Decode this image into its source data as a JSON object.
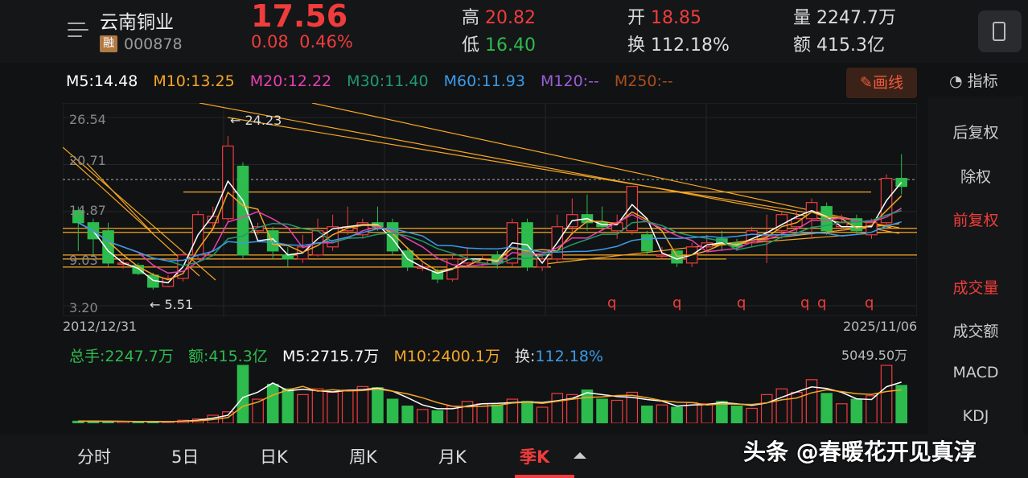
{
  "header": {
    "name": "云南铜业",
    "rong": "融",
    "code": "000878",
    "price": "17.56",
    "change": "0.08",
    "change_pct": "0.46%",
    "high_label": "高",
    "high": "20.82",
    "low_label": "低",
    "low": "16.40",
    "open_label": "开",
    "open": "18.85",
    "turnover_label": "换",
    "turnover": "112.18%",
    "volume_label": "量",
    "volume": "2247.7万",
    "amount_label": "额",
    "amount": "415.3亿"
  },
  "ma": {
    "m5": "M5:14.48",
    "m10": "M10:13.25",
    "m20": "M20:12.22",
    "m30": "M30:11.40",
    "m60": "M60:11.93",
    "m120": "M120:--",
    "m250": "M250:--"
  },
  "draw_button": "画线",
  "indicator_label": "指标",
  "chart": {
    "y_labels": [
      "26.54",
      "20.71",
      "14.87",
      "9.03",
      "3.20"
    ],
    "annot_high": "24.23",
    "annot_low": "5.51",
    "date_start": "2012/12/31",
    "date_end": "2025/11/06",
    "q_markers": [
      "q",
      "q",
      "q",
      "q",
      "q",
      "q"
    ]
  },
  "volume": {
    "total": "总手:2247.7万",
    "amount": "额:415.3亿",
    "m5": "M5:2715.7万",
    "m10": "M10:2400.1万",
    "turnover_label": "换:",
    "turnover": "112.18%",
    "max": "5049.50万"
  },
  "right_panel": {
    "items": [
      "后复权",
      "除权",
      "前复权",
      "成交量",
      "成交额",
      "MACD",
      "KDJ"
    ]
  },
  "tabs": [
    "分时",
    "5日",
    "日K",
    "周K",
    "月K",
    "季K"
  ],
  "watermark": "头条 @春暖花开见真淳",
  "colors": {
    "up": "#f03c3c",
    "down": "#2dbb4d",
    "accent": "#f05a3c"
  },
  "chart_data": {
    "type": "candlestick",
    "ylim": [
      3.2,
      26.54
    ],
    "candles": [
      {
        "o": 15.0,
        "c": 13.5,
        "h": 15.5,
        "l": 10.0
      },
      {
        "o": 13.5,
        "c": 11.5,
        "h": 14.0,
        "l": 9.5
      },
      {
        "o": 12.5,
        "c": 8.5,
        "h": 13.5,
        "l": 8.0
      },
      {
        "o": 8.5,
        "c": 8.5,
        "h": 9.0,
        "l": 7.8
      },
      {
        "o": 8.2,
        "c": 7.2,
        "h": 8.5,
        "l": 7.0
      },
      {
        "o": 7.0,
        "c": 5.5,
        "h": 7.3,
        "l": 5.2
      },
      {
        "o": 5.6,
        "c": 6.6,
        "h": 7.0,
        "l": 5.5
      },
      {
        "o": 6.6,
        "c": 9.5,
        "h": 10.0,
        "l": 6.2
      },
      {
        "o": 9.5,
        "c": 14.5,
        "h": 15.0,
        "l": 9.0
      },
      {
        "o": 13.5,
        "c": 14.3,
        "h": 15.5,
        "l": 12.5
      },
      {
        "o": 14.0,
        "c": 23.0,
        "h": 24.23,
        "l": 13.5
      },
      {
        "o": 20.5,
        "c": 9.5,
        "h": 21.0,
        "l": 9.0
      },
      {
        "o": 12.5,
        "c": 13.0,
        "h": 13.5,
        "l": 12.0
      },
      {
        "o": 12.5,
        "c": 10.0,
        "h": 13.0,
        "l": 9.0
      },
      {
        "o": 9.5,
        "c": 9.0,
        "h": 10.5,
        "l": 8.0
      },
      {
        "o": 9.0,
        "c": 10.5,
        "h": 12.0,
        "l": 8.5
      },
      {
        "o": 9.5,
        "c": 12.5,
        "h": 14.0,
        "l": 9.3
      },
      {
        "o": 10.5,
        "c": 13.0,
        "h": 14.5,
        "l": 10.0
      },
      {
        "o": 12.5,
        "c": 13.0,
        "h": 15.5,
        "l": 12.0
      },
      {
        "o": 12.0,
        "c": 13.5,
        "h": 14.0,
        "l": 11.5
      },
      {
        "o": 13.5,
        "c": 13.0,
        "h": 15.5,
        "l": 12.5
      },
      {
        "o": 13.5,
        "c": 10.0,
        "h": 14.0,
        "l": 9.5
      },
      {
        "o": 10.0,
        "c": 8.0,
        "h": 10.5,
        "l": 7.5
      },
      {
        "o": 8.0,
        "c": 8.0,
        "h": 8.5,
        "l": 7.5
      },
      {
        "o": 7.5,
        "c": 6.5,
        "h": 7.8,
        "l": 6.0
      },
      {
        "o": 6.5,
        "c": 9.0,
        "h": 9.5,
        "l": 6.2
      },
      {
        "o": 8.5,
        "c": 9.0,
        "h": 10.5,
        "l": 8.0
      },
      {
        "o": 8.5,
        "c": 9.0,
        "h": 9.5,
        "l": 8.0
      },
      {
        "o": 9.5,
        "c": 8.5,
        "h": 10.0,
        "l": 7.8
      },
      {
        "o": 8.5,
        "c": 13.5,
        "h": 14.0,
        "l": 8.0
      },
      {
        "o": 13.5,
        "c": 8.0,
        "h": 14.0,
        "l": 7.5
      },
      {
        "o": 8.0,
        "c": 9.0,
        "h": 9.5,
        "l": 7.5
      },
      {
        "o": 9.0,
        "c": 13.0,
        "h": 14.5,
        "l": 8.5
      },
      {
        "o": 13.0,
        "c": 14.5,
        "h": 16.5,
        "l": 12.0
      },
      {
        "o": 14.5,
        "c": 13.5,
        "h": 17.0,
        "l": 12.5
      },
      {
        "o": 13.5,
        "c": 13.0,
        "h": 15.5,
        "l": 12.5
      },
      {
        "o": 12.5,
        "c": 13.5,
        "h": 14.5,
        "l": 11.5
      },
      {
        "o": 12.5,
        "c": 18.0,
        "h": 18.0,
        "l": 12.0
      },
      {
        "o": 12.0,
        "c": 10.0,
        "h": 12.5,
        "l": 9.5
      },
      {
        "o": 9.5,
        "c": 9.5,
        "h": 10.5,
        "l": 9.0
      },
      {
        "o": 10.0,
        "c": 8.5,
        "h": 10.0,
        "l": 8.0
      },
      {
        "o": 8.5,
        "c": 10.5,
        "h": 11.0,
        "l": 8.0
      },
      {
        "o": 10.5,
        "c": 11.0,
        "h": 12.0,
        "l": 10.0
      },
      {
        "o": 11.5,
        "c": 11.0,
        "h": 12.5,
        "l": 10.0
      },
      {
        "o": 11.0,
        "c": 10.5,
        "h": 11.5,
        "l": 10.0
      },
      {
        "o": 11.0,
        "c": 12.5,
        "h": 13.0,
        "l": 10.5
      },
      {
        "o": 12.0,
        "c": 12.0,
        "h": 14.5,
        "l": 8.5
      },
      {
        "o": 12.5,
        "c": 14.5,
        "h": 15.0,
        "l": 11.5
      },
      {
        "o": 13.0,
        "c": 14.0,
        "h": 15.0,
        "l": 12.0
      },
      {
        "o": 14.0,
        "c": 16.0,
        "h": 16.5,
        "l": 11.5
      },
      {
        "o": 15.5,
        "c": 12.5,
        "h": 16.0,
        "l": 12.0
      },
      {
        "o": 13.0,
        "c": 13.5,
        "h": 14.5,
        "l": 12.5
      },
      {
        "o": 14.0,
        "c": 12.5,
        "h": 14.5,
        "l": 12.0
      },
      {
        "o": 12.0,
        "c": 13.5,
        "h": 14.0,
        "l": 11.5
      },
      {
        "o": 13.5,
        "c": 19.0,
        "h": 19.5,
        "l": 13.0
      },
      {
        "o": 19.0,
        "c": 18.0,
        "h": 22.0,
        "l": 17.0
      }
    ],
    "volume": [
      180,
      190,
      160,
      150,
      140,
      130,
      140,
      260,
      380,
      700,
      1000,
      5049,
      2100,
      3400,
      3000,
      2500,
      3000,
      2700,
      2900,
      3200,
      3100,
      2100,
      1500,
      1200,
      1100,
      1500,
      1900,
      1700,
      1600,
      2100,
      1900,
      1400,
      2600,
      2500,
      2900,
      2100,
      2000,
      2700,
      1500,
      1600,
      1400,
      1800,
      1700,
      1900,
      1500,
      1300,
      2500,
      3000,
      2700,
      3800,
      2600,
      1700,
      2100,
      2400,
      5049,
      3300
    ]
  }
}
